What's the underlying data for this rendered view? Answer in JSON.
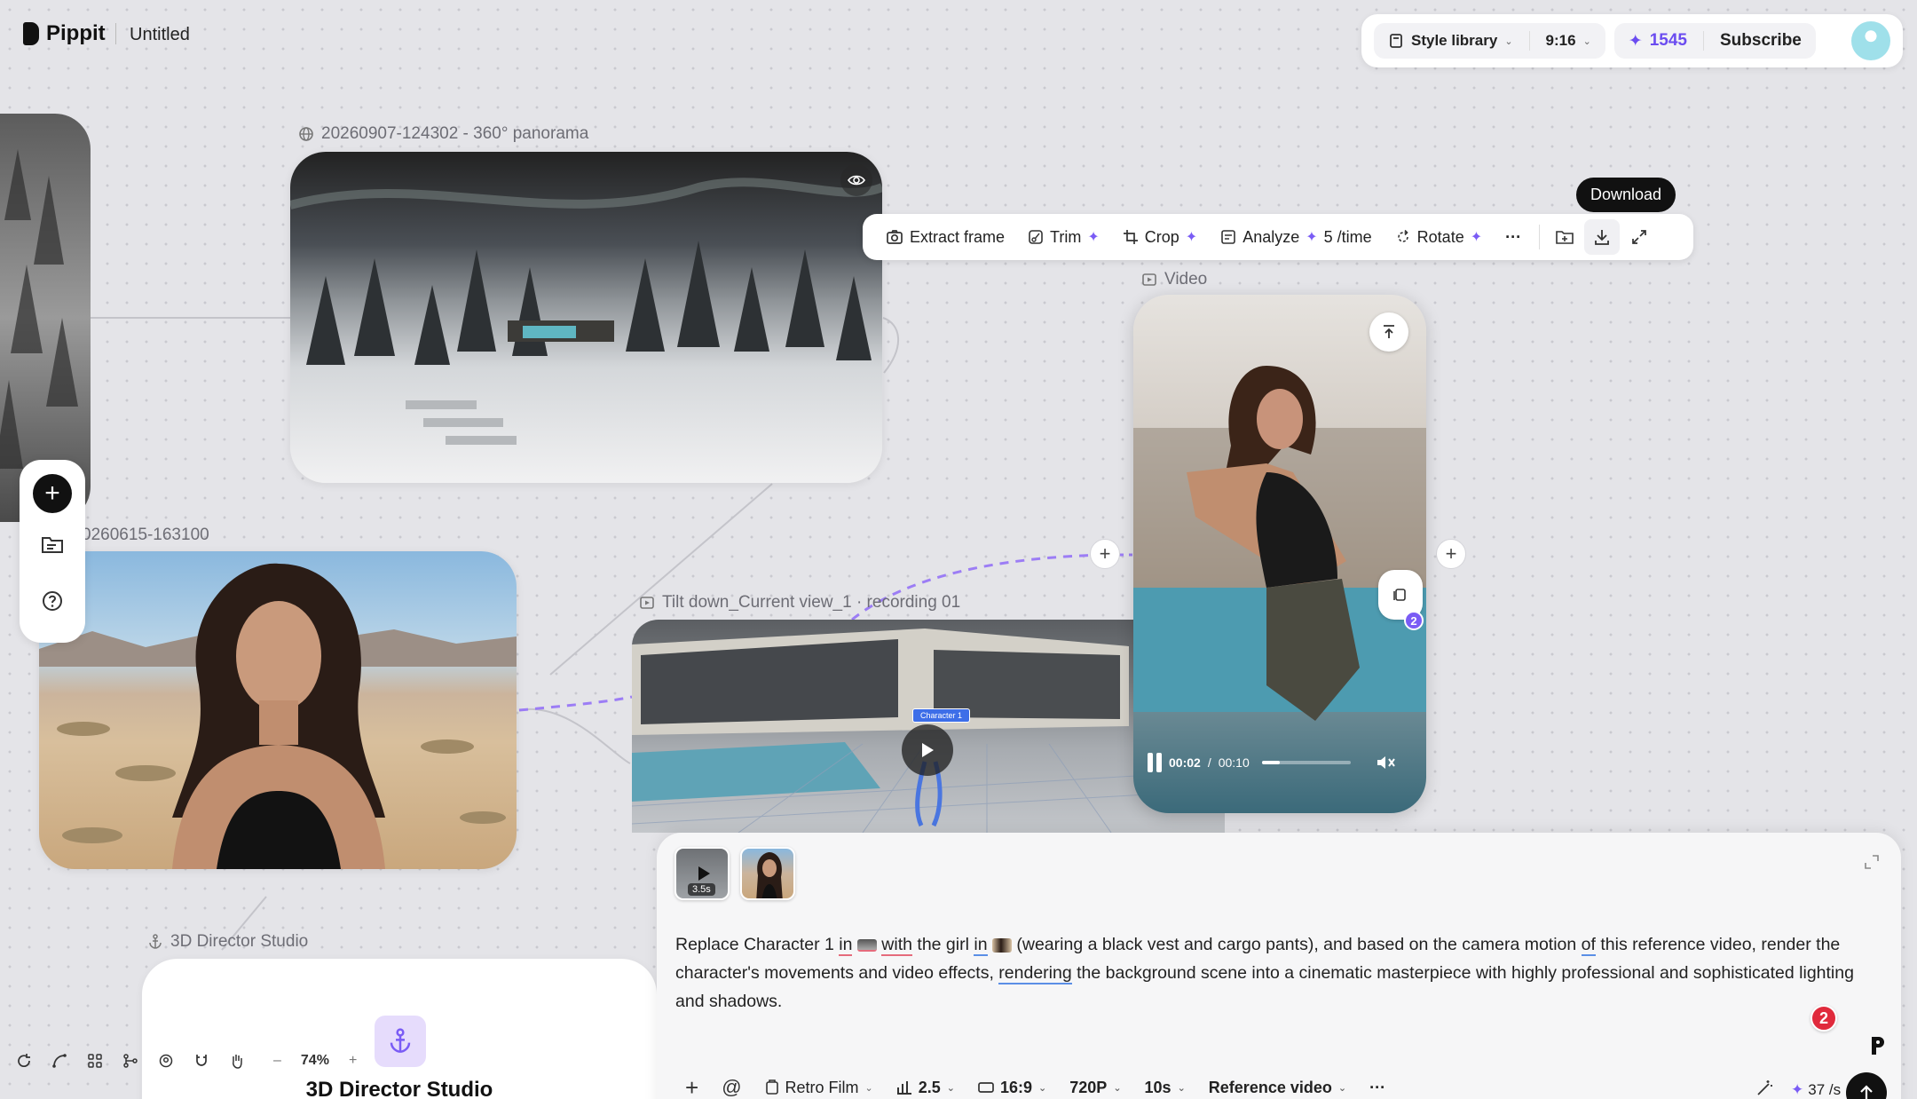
{
  "app": {
    "name": "Pippit",
    "document_title": "Untitled"
  },
  "topbar": {
    "style_library": "Style library",
    "aspect": "9:16",
    "credits": "1545",
    "subscribe": "Subscribe"
  },
  "nodes": {
    "panorama_label": "20260907-124302 - 360° panorama",
    "photo_label": "0260615-163100",
    "recording_label": "Tilt down_Current view_1 · recording 01",
    "recording_tag": "Character 1",
    "video_label": "Video",
    "director_label": "3D Director Studio",
    "director_title": "3D Director Studio"
  },
  "toolbar": {
    "extract_frame": "Extract frame",
    "trim": "Trim",
    "crop": "Crop",
    "analyze": "Analyze",
    "analyze_cost": "5 /time",
    "rotate": "Rotate",
    "more": "···",
    "tooltip": "Download"
  },
  "video_player": {
    "time_current": "00:02",
    "time_sep": "/",
    "time_total": "00:10",
    "progress": 0.2,
    "badge_count": "2"
  },
  "prompt": {
    "thumb_duration": "3.5s",
    "text_1": "Replace Character 1 ",
    "text_in": "in",
    "text_with": "with",
    "text_2": " the girl ",
    "text_in2": "in",
    "text_3": " (wearing a black vest and cargo pants), and based on the camera motion ",
    "text_of": "of",
    "text_4": " this reference video, render the character's movements and video effects, ",
    "text_rendering": "rendering",
    "text_5": " the background scene into a cinematic masterpiece with highly professional and sophisticated lighting and shadows.",
    "notif_count": "2",
    "style": "Retro Film",
    "strength": "2.5",
    "ratio": "16:9",
    "resolution": "720P",
    "duration": "10s",
    "mode": "Reference video",
    "more": "···",
    "cost": "37 /s"
  },
  "bottombar": {
    "zoom": "74%",
    "minus": "–",
    "plus": "+"
  }
}
